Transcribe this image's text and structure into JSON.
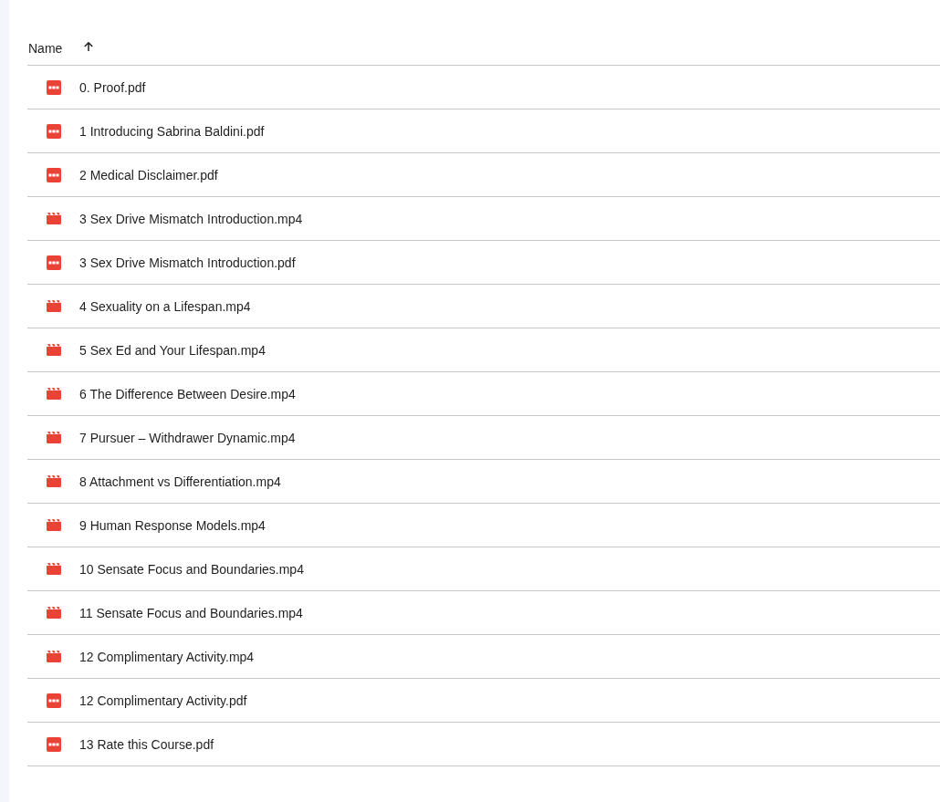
{
  "table": {
    "columns": [
      {
        "label": "Name",
        "sort_ascending": true
      }
    ],
    "rows": [
      {
        "name": "0. Proof.pdf",
        "kind": "pdf"
      },
      {
        "name": "1 Introducing Sabrina Baldini.pdf",
        "kind": "pdf"
      },
      {
        "name": "2 Medical Disclaimer.pdf",
        "kind": "pdf"
      },
      {
        "name": "3 Sex Drive Mismatch Introduction.mp4",
        "kind": "video"
      },
      {
        "name": "3 Sex Drive Mismatch Introduction.pdf",
        "kind": "pdf"
      },
      {
        "name": "4 Sexuality on a Lifespan.mp4",
        "kind": "video"
      },
      {
        "name": "5 Sex Ed and Your Lifespan.mp4",
        "kind": "video"
      },
      {
        "name": "6 The Difference Between Desire.mp4",
        "kind": "video"
      },
      {
        "name": "7 Pursuer – Withdrawer Dynamic.mp4",
        "kind": "video"
      },
      {
        "name": "8 Attachment vs Differentiation.mp4",
        "kind": "video"
      },
      {
        "name": "9 Human Response Models.mp4",
        "kind": "video"
      },
      {
        "name": "10 Sensate Focus and Boundaries.mp4",
        "kind": "video"
      },
      {
        "name": "11 Sensate Focus and Boundaries.mp4",
        "kind": "video"
      },
      {
        "name": "12 Complimentary Activity.mp4",
        "kind": "video"
      },
      {
        "name": "12 Complimentary Activity.pdf",
        "kind": "pdf"
      },
      {
        "name": "13 Rate this Course.pdf",
        "kind": "pdf"
      }
    ]
  }
}
